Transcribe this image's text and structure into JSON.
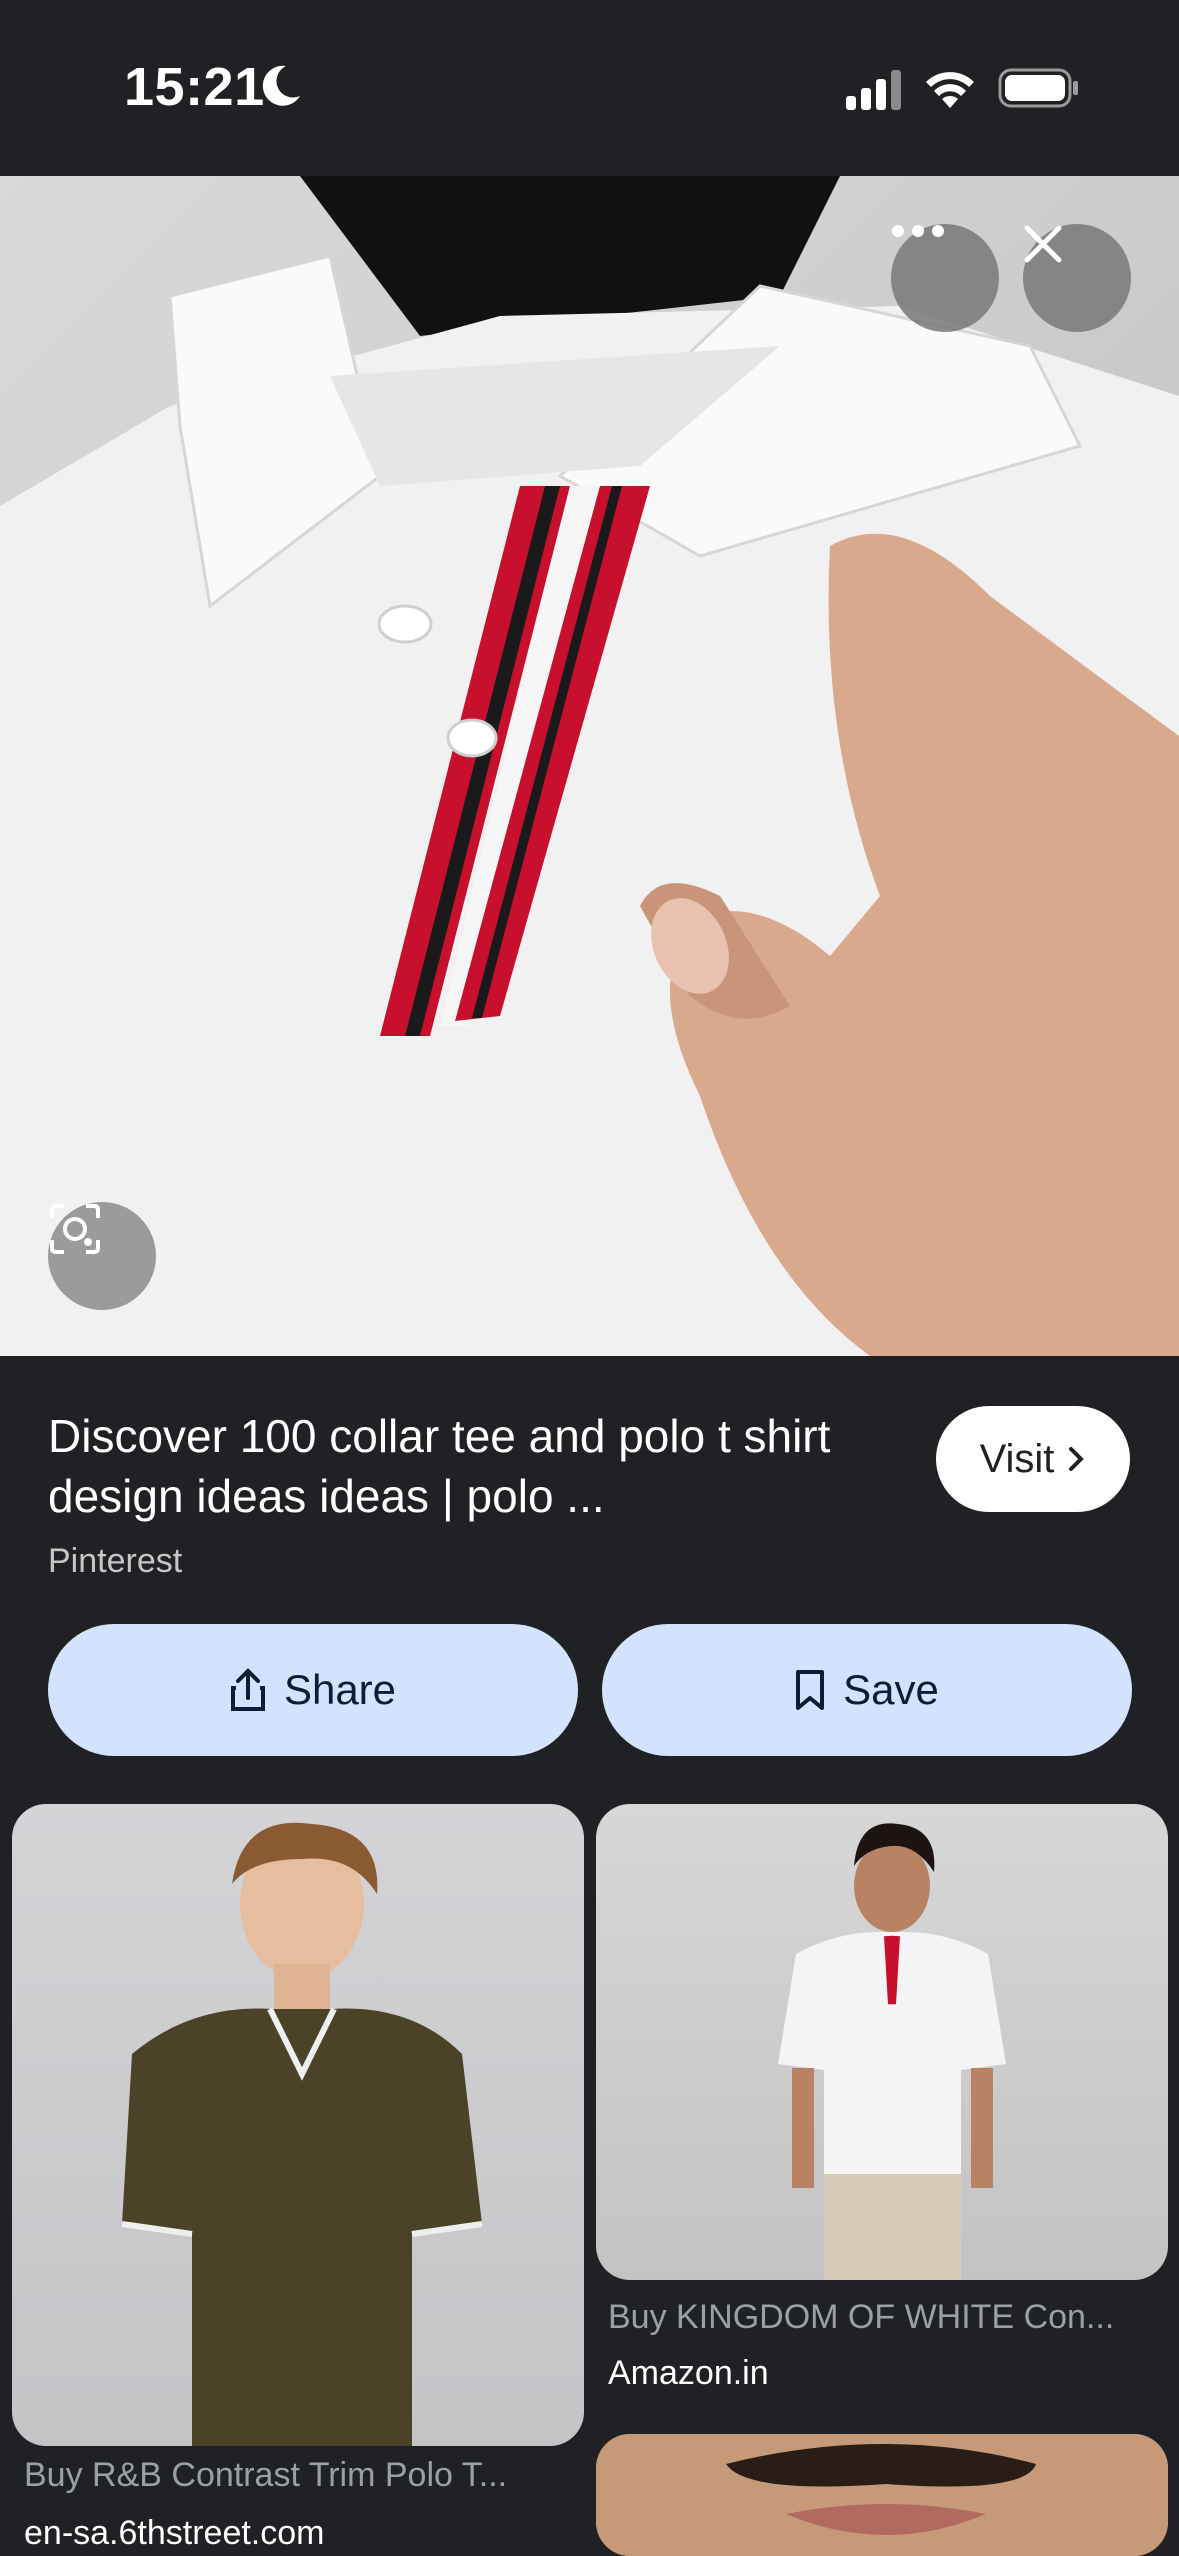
{
  "status": {
    "time": "15:21",
    "icons": [
      "moon-icon",
      "signal-icon",
      "wifi-icon",
      "battery-icon"
    ]
  },
  "hero": {
    "image_alt": "white polo shirt with red and black striped placket",
    "more_icon": "more-horizontal-icon",
    "close_icon": "close-icon",
    "lens_icon": "lens-search-icon"
  },
  "result": {
    "title": "Discover 100 collar tee and polo t shirt design ideas ideas | polo ...",
    "source": "Pinterest",
    "visit_label": "Visit",
    "share_label": "Share",
    "save_label": "Save"
  },
  "related": [
    {
      "caption": "Buy R&B Contrast Trim Polo T...",
      "domain": "en-sa.6thstreet.com"
    },
    {
      "caption": "Buy KINGDOM OF WHITE Con...",
      "domain": "Amazon.in"
    }
  ],
  "colors": {
    "background": "#202124",
    "button_fill": "#d3e3fd",
    "visit_fill": "#ffffff"
  }
}
